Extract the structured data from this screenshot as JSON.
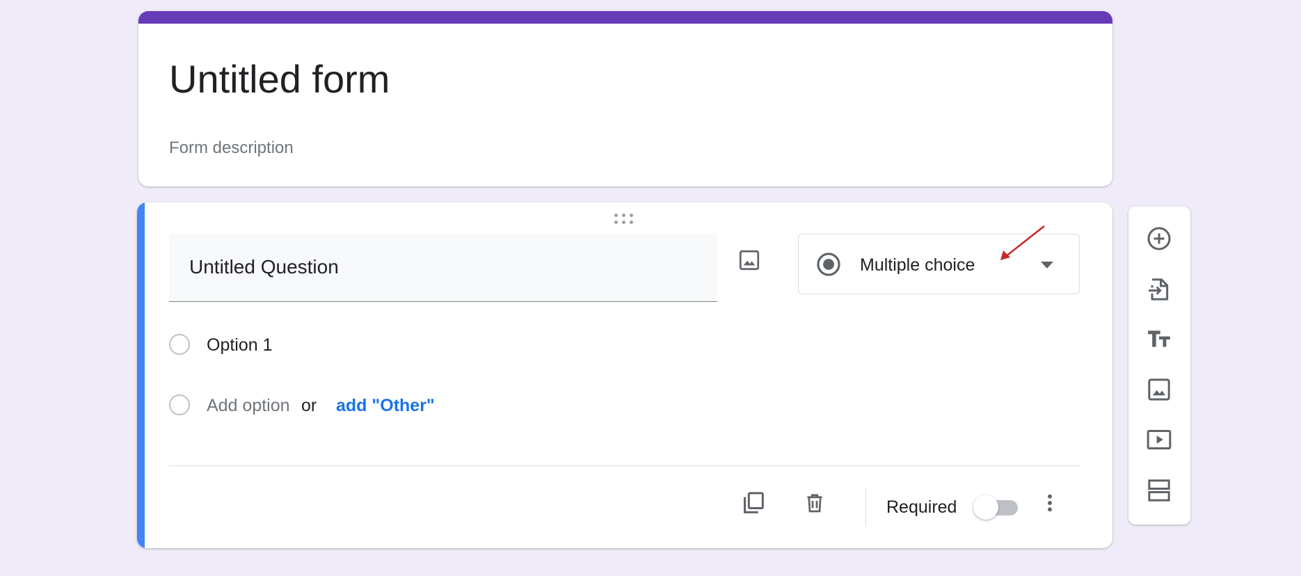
{
  "colors": {
    "theme_purple": "#673ab7",
    "active_blue": "#4285f4",
    "link_blue": "#1a73e8",
    "icon_gray": "#5f6368",
    "background": "#f0ebf8"
  },
  "form": {
    "title": "Untitled form",
    "description_placeholder": "Form description"
  },
  "question": {
    "title": "Untitled Question",
    "type": "Multiple choice",
    "options": [
      "Option 1"
    ],
    "add_option": "Add option",
    "or": "or",
    "add_other": "add \"Other\"",
    "required_label": "Required",
    "required": false
  },
  "icons": {
    "drag": "drag-handle-icon",
    "image": "image-icon",
    "type": "radio-button-checked-icon",
    "caret": "arrow-drop-down-icon",
    "duplicate": "content-copy-icon",
    "delete": "trash-icon",
    "more": "more-vert-icon"
  },
  "toolbar": {
    "items": [
      {
        "name": "add-question",
        "icon": "add-circle-icon"
      },
      {
        "name": "import-questions",
        "icon": "import-file-icon"
      },
      {
        "name": "add-title-description",
        "icon": "title-text-icon"
      },
      {
        "name": "add-image",
        "icon": "image-icon"
      },
      {
        "name": "add-video",
        "icon": "video-icon"
      },
      {
        "name": "add-section",
        "icon": "section-icon"
      }
    ]
  }
}
